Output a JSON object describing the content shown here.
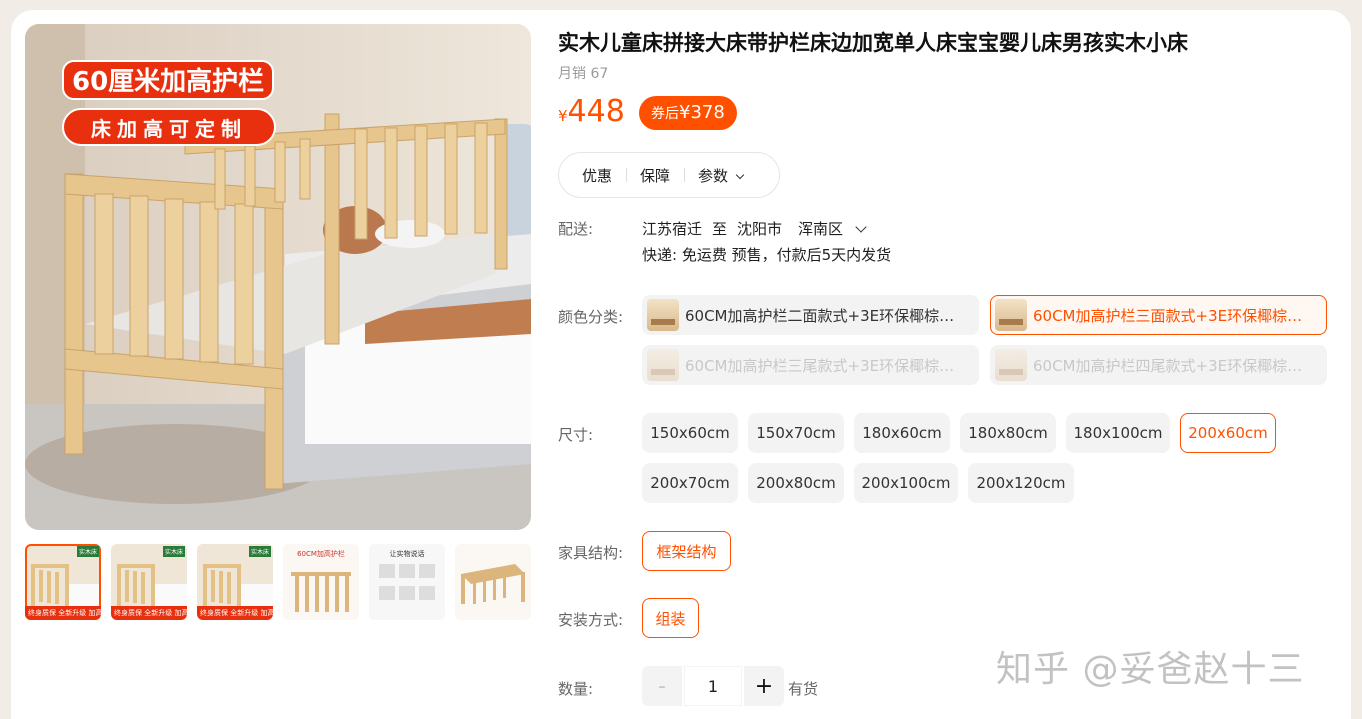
{
  "gallery": {
    "promo_primary": "60厘米加高护栏",
    "promo_secondary": "床加高可定制",
    "thumbnails": [
      {
        "badge": "终身质保 全新升级 加高护栏",
        "tag": "实木床"
      },
      {
        "badge": "终身质保 全新升级 加高护栏",
        "tag": "实木床"
      },
      {
        "badge": "终身质保 全新升级 加高护栏",
        "tag": "实木床"
      },
      {
        "label": "60CM加高护栏"
      },
      {
        "label": "让实物说话"
      },
      {
        "label": ""
      }
    ]
  },
  "product": {
    "title": "实木儿童床拼接大床带护栏床边加宽单人床宝宝婴儿床男孩实木小床",
    "sales": "月销 67",
    "price_currency": "¥",
    "price": "448",
    "coupon_label": "券后",
    "coupon_price": "¥378"
  },
  "tabs": [
    "优惠",
    "保障",
    "参数"
  ],
  "delivery": {
    "label": "配送:",
    "from": "江苏宿迁",
    "to_word": "至",
    "city": "沈阳市",
    "district": "浑南区",
    "shipping": "快递: 免运费  预售，付款后5天内发货"
  },
  "color": {
    "label": "颜色分类:",
    "options": [
      {
        "text": "60CM加高护栏二面款式+3E环保椰棕…",
        "state": "normal"
      },
      {
        "text": "60CM加高护栏三面款式+3E环保椰棕…",
        "state": "selected"
      },
      {
        "text": "60CM加高护栏三尾款式+3E环保椰棕…",
        "state": "disabled"
      },
      {
        "text": "60CM加高护栏四尾款式+3E环保椰棕…",
        "state": "disabled"
      }
    ]
  },
  "size": {
    "label": "尺寸:",
    "options": [
      "150x60cm",
      "150x70cm",
      "180x60cm",
      "180x80cm",
      "180x100cm",
      "200x60cm",
      "200x70cm",
      "200x80cm",
      "200x100cm",
      "200x120cm"
    ],
    "selected": "200x60cm"
  },
  "structure": {
    "label": "家具结构:",
    "value": "框架结构"
  },
  "install": {
    "label": "安装方式:",
    "value": "组装"
  },
  "quantity": {
    "label": "数量:",
    "value": "1",
    "minus": "-",
    "plus": "+",
    "stock": "有货"
  },
  "watermark": "知乎 @妥爸赵十三",
  "colors": {
    "accent": "#ff5000",
    "promo_red": "#e8300f"
  }
}
